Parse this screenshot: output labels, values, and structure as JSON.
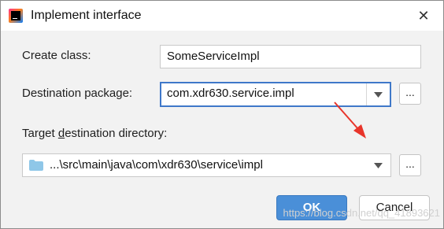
{
  "window": {
    "title": "Implement interface",
    "close_glyph": "✕"
  },
  "form": {
    "create_class_label": "Create class:",
    "create_class_value": "SomeServiceImpl",
    "destination_package_label": "Destination package:",
    "destination_package_value": "com.xdr630.service.impl",
    "target_directory_label_pre": "Target ",
    "target_directory_label_mnemonic": "d",
    "target_directory_label_post": "estination directory:",
    "target_directory_value": "...\\src\\main\\java\\com\\xdr630\\service\\impl",
    "browse_label": "..."
  },
  "buttons": {
    "ok_label": "OK",
    "cancel_label": "Cancel"
  },
  "overlay": {
    "watermark": "https://blog.csdn.net/qq_41893621",
    "annotation_arrow_color": "#e8352b"
  },
  "colors": {
    "accent": "#4a8fd8",
    "focus_border": "#3f78c9",
    "folder": "#8fc7e8"
  }
}
